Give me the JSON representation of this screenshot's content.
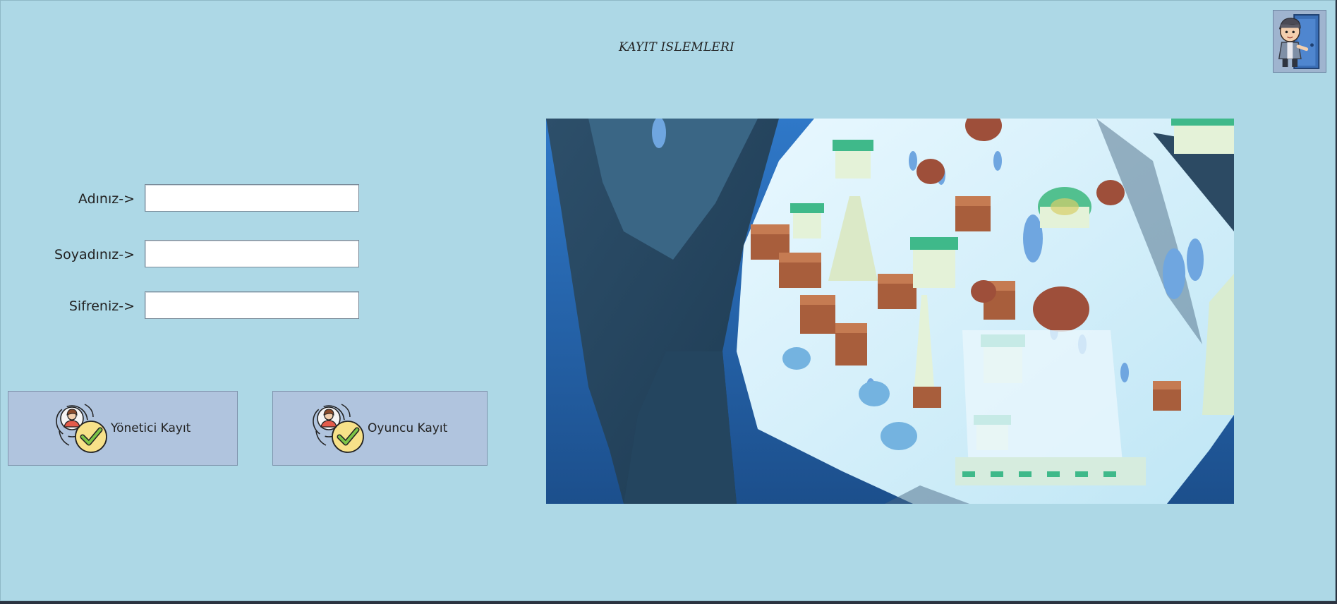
{
  "window": {
    "title": "KAYIT ISLEMLERI",
    "background": "#add8e6"
  },
  "exit": {
    "icon": "person-exit-door-icon"
  },
  "form": {
    "fields": [
      {
        "label": "Adınız->",
        "value": ""
      },
      {
        "label": "Soyadınız->",
        "value": ""
      },
      {
        "label": "Sifreniz->",
        "value": ""
      }
    ]
  },
  "buttons": {
    "admin": {
      "label": "Yönetici Kayıt",
      "icon": "user-check-icon"
    },
    "player": {
      "label": "Oyuncu Kayıt",
      "icon": "user-check-icon"
    }
  },
  "image": {
    "subject": "isometric-snowy-village-illustration"
  },
  "colors": {
    "button_bg": "#b0c4de",
    "exit_bg": "#9fb4cf"
  }
}
